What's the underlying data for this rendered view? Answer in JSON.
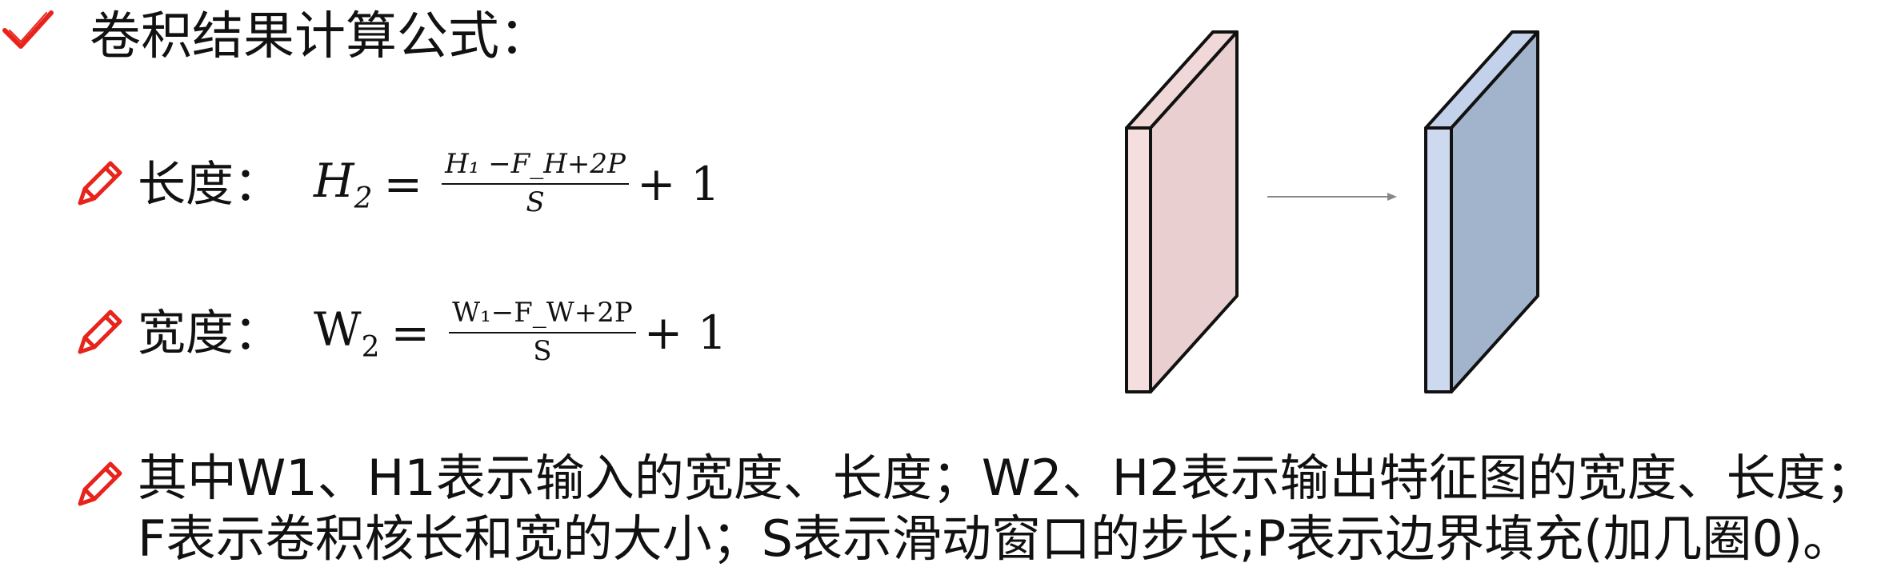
{
  "colors": {
    "accent_red": "#e8231b",
    "box_pink_front": "#e9cfcf",
    "box_pink_side": "#f5dede",
    "box_blue_front": "#a2b4cc",
    "box_blue_side": "#cdd9ef",
    "arrow": "#888888"
  },
  "icons": {
    "title_icon": "check-icon",
    "bullet_icon": "pencil-icon"
  },
  "title": "卷积结果计算公式：",
  "height_formula": {
    "label": "长度：",
    "lhs": "H",
    "lhs_sub": "2",
    "numerator": "H₁ −F_H+2P",
    "denominator": "S",
    "rhs": "+ 1"
  },
  "width_formula": {
    "label": "宽度：",
    "lhs": "W",
    "lhs_sub": "2",
    "numerator": "W₁−F_W+2P",
    "denominator": "S",
    "rhs": "+ 1"
  },
  "description": {
    "line1": "其中W1、H1表示输入的宽度、长度；W2、H2表示输出特征图的宽度、长度；",
    "line2": "F表示卷积核长和宽的大小；S表示滑动窗口的步长;P表示边界填充(加几圈0)。"
  }
}
